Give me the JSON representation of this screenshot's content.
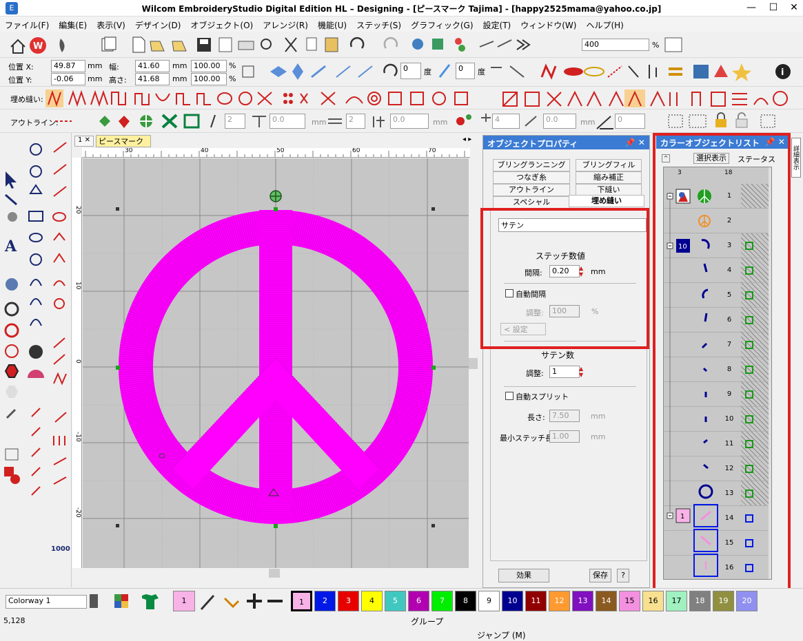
{
  "window": {
    "title": "Wilcom EmbroideryStudio Digital Edition HL – Designing - [ピースマーク        Tajima] - [happy2525mama@yahoo.co.jp]",
    "app_icon": "E"
  },
  "menu": [
    "ファイル(F)",
    "編集(E)",
    "表示(V)",
    "デザイン(D)",
    "オブジェクト(O)",
    "アレンジ(R)",
    "機能(U)",
    "ステッチ(S)",
    "グラフィック(G)",
    "設定(T)",
    "ウィンドウ(W)",
    "ヘルプ(H)"
  ],
  "toolbar": {
    "zoom_value": "400",
    "zoom_unit": "%"
  },
  "position": {
    "label_x": "位置 X:",
    "value_x": "49.87",
    "label_y": "位置 Y:",
    "value_y": "-0.06",
    "unit": "mm",
    "width_label": "幅:",
    "width": "41.60",
    "height_label": "高さ:",
    "height": "41.68",
    "scale_w": "100.00",
    "scale_h": "100.00",
    "pct": "%",
    "rot1": "0",
    "rot2": "0",
    "deg": "度"
  },
  "fill_bar": {
    "label": "埋め縫い:"
  },
  "outline_bar": {
    "label": "アウトライン:",
    "v1": "2",
    "v2": "0.0",
    "v3": "2",
    "v4": "0.0",
    "v5": "4",
    "v6": "0.0",
    "v7": "0",
    "mm": "mm"
  },
  "doc": {
    "tab_num": "1",
    "tab_name": "ピースマーク",
    "ruler_top": [
      "30",
      "40",
      "50",
      "60",
      "70"
    ],
    "ruler_left": [
      "20",
      "10",
      "0",
      "-10",
      "-20"
    ]
  },
  "props": {
    "title": "オブジェクトプロパティ",
    "tabs": [
      "ブリングランニング",
      "ブリングフィル",
      "つなぎ糸",
      "縮み補正",
      "アウトライン",
      "下縫い",
      "スペシャル",
      "埋め縫い"
    ],
    "stitch_type": "サテン",
    "stitch_value_hdr": "ステッチ数値",
    "spacing_label": "間隔:",
    "spacing": "0.20",
    "mm": "mm",
    "auto_spacing": "自動間隔",
    "adjust_label": "調整:",
    "adjust_val": "100",
    "pct": "%",
    "settings": "設定",
    "satin_hdr": "サテン数",
    "satin_adjust": "1",
    "auto_split": "自動スプリット",
    "length_label": "長さ:",
    "length": "7.50",
    "min_label": "最小ステッチ長:",
    "min_len": "1.00",
    "effect_btn": "効果",
    "save_btn": "保存",
    "help_btn": "?"
  },
  "color_list": {
    "title": "カラーオブジェクトリスト",
    "btn_select": "選択表示",
    "status": "ステータス",
    "col_a": "3",
    "col_b": "18",
    "side_tab": "詳細表示",
    "rows": [
      "1",
      "2",
      "3",
      "4",
      "5",
      "6",
      "7",
      "8",
      "9",
      "10",
      "11",
      "12",
      "13",
      "14",
      "15",
      "16"
    ],
    "group_a": "10",
    "group_b": "1"
  },
  "colorway": {
    "label": "Colorway 1",
    "current": "1",
    "swatches": [
      {
        "n": "1",
        "c": "#f7b2e6"
      },
      {
        "n": "2",
        "c": "#0019e6"
      },
      {
        "n": "3",
        "c": "#e60000"
      },
      {
        "n": "4",
        "c": "#ffff00"
      },
      {
        "n": "5",
        "c": "#40c8c0"
      },
      {
        "n": "6",
        "c": "#b000b0"
      },
      {
        "n": "7",
        "c": "#00ee00"
      },
      {
        "n": "8",
        "c": "#000000"
      },
      {
        "n": "9",
        "c": "#ffffff"
      },
      {
        "n": "10",
        "c": "#000090"
      },
      {
        "n": "11",
        "c": "#900000"
      },
      {
        "n": "12",
        "c": "#ff9a30"
      },
      {
        "n": "13",
        "c": "#8010c0"
      },
      {
        "n": "14",
        "c": "#8a5a20"
      },
      {
        "n": "15",
        "c": "#f490e0"
      },
      {
        "n": "16",
        "c": "#f8e090"
      },
      {
        "n": "17",
        "c": "#a0f0c0"
      },
      {
        "n": "18",
        "c": "#808080"
      },
      {
        "n": "19",
        "c": "#909040"
      },
      {
        "n": "20",
        "c": "#9090f0"
      }
    ]
  },
  "status": {
    "coords": "5,128",
    "group": "グループ",
    "jump": "ジャンプ (M)"
  },
  "colors": {
    "stitch": "#ff00ff",
    "highlight": "#e02020",
    "panel": "#3b7bd4"
  }
}
